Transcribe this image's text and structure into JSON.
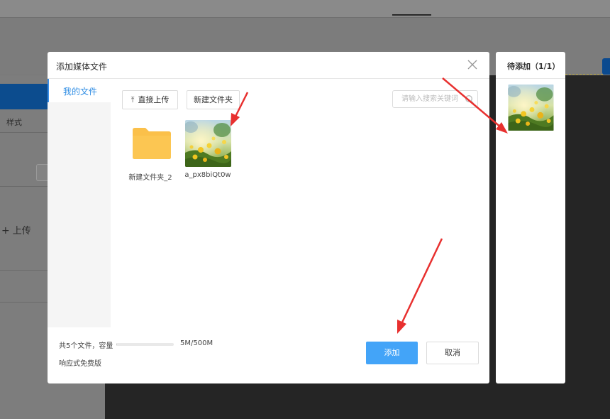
{
  "background": {
    "style_label": "样式",
    "upload_label": "上传"
  },
  "dialog": {
    "title": "添加媒体文件",
    "sidebar": {
      "items": [
        {
          "label": "我的文件",
          "active": true
        }
      ]
    },
    "toolbar": {
      "upload_label": "直接上传",
      "new_folder_label": "新建文件夹",
      "search_placeholder": "请输入搜索关键词"
    },
    "files": [
      {
        "type": "folder",
        "name": "新建文件夹_2",
        "icon": "folder-icon"
      },
      {
        "type": "image",
        "name": "a_px8biQt0w"
      }
    ],
    "footer": {
      "stats": "共5个文件，容量",
      "usage": "5M/500M",
      "usage_fraction": 0.01,
      "edition": "响应式免费版",
      "add_label": "添加",
      "cancel_label": "取消"
    }
  },
  "pending": {
    "title": "待添加（1/1）"
  },
  "colors": {
    "accent": "#3a8ee6",
    "primary_button": "#43a4f8",
    "folder": "#fbc04a",
    "annotation_arrow": "#e8302f",
    "overlay": "#7a7a7a"
  }
}
